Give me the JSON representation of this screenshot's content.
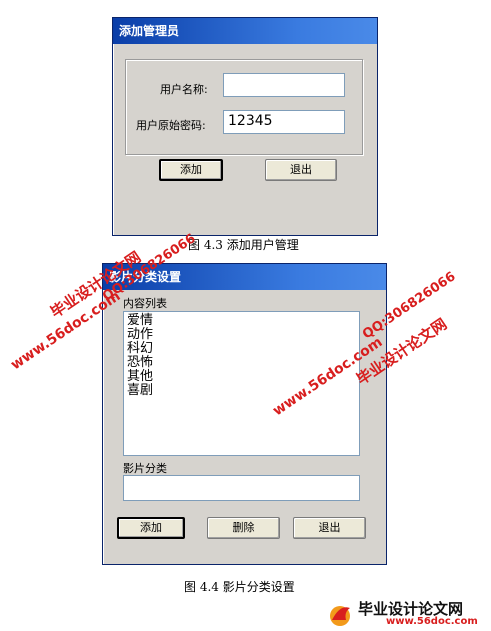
{
  "dialog1": {
    "title": "添加管理员",
    "username_label": "用户名称:",
    "username_value": "",
    "password_label": "用户原始密码:",
    "password_value": "12345",
    "add_button": "添加",
    "exit_button": "退出"
  },
  "caption1": "图 4.3  添加用户管理",
  "dialog2": {
    "title": "影片分类设置",
    "list_label": "内容列表",
    "list_items": [
      "爱情",
      "动作",
      "科幻",
      "恐怖",
      "其他",
      "喜剧"
    ],
    "category_label": "影片分类",
    "category_value": "",
    "add_button": "添加",
    "delete_button": "删除",
    "exit_button": "退出"
  },
  "caption2": "图 4.4 影片分类设置",
  "watermark": {
    "site_cn": "毕业设计论文网",
    "url": "www.56doc.com",
    "qq": "QQ:306826066",
    "logo_url": "www.56doc.com",
    "colors": {
      "red": "#d81e1e",
      "blue": "#1a56c8"
    }
  }
}
